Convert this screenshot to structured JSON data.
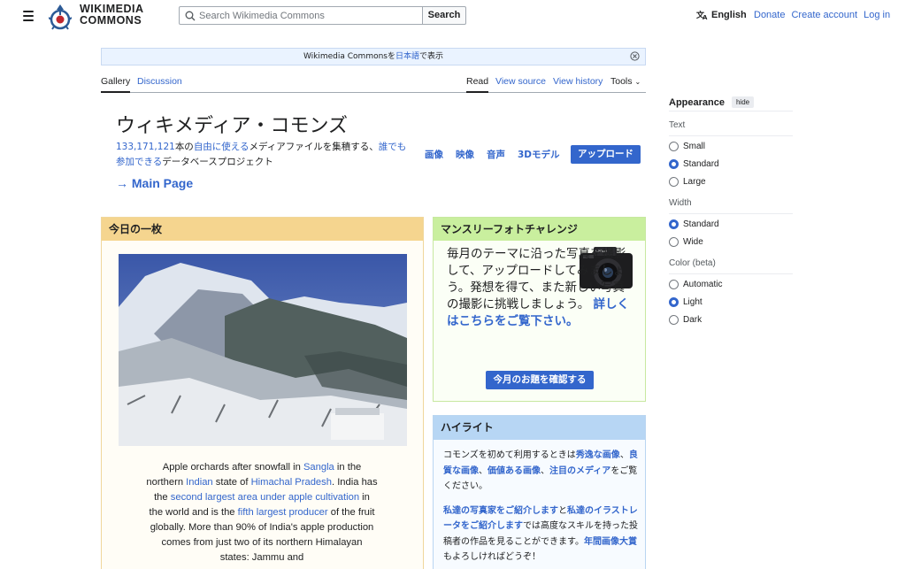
{
  "header": {
    "logo_line1": "WIKIMEDIA",
    "logo_line2": "COMMONS",
    "search_placeholder": "Search Wikimedia Commons",
    "search_button": "Search",
    "language": "English",
    "nav": [
      "Donate",
      "Create account",
      "Log in"
    ]
  },
  "banner": {
    "text_before": "Wikimedia Commonsを",
    "link": "日本語",
    "text_after": "で表示"
  },
  "tabs": {
    "gallery": "Gallery",
    "discussion": "Discussion",
    "read": "Read",
    "view_source": "View source",
    "view_history": "View history",
    "tools": "Tools"
  },
  "appearance": {
    "title": "Appearance",
    "hide": "hide",
    "text_label": "Text",
    "text_options": [
      "Small",
      "Standard",
      "Large"
    ],
    "text_selected": "Standard",
    "width_label": "Width",
    "width_options": [
      "Standard",
      "Wide"
    ],
    "width_selected": "Standard",
    "color_label": "Color (beta)",
    "color_options": [
      "Automatic",
      "Light",
      "Dark"
    ],
    "color_selected": "Light"
  },
  "main": {
    "title": "ウィキメディア・コモンズ",
    "count": "133,171,121",
    "intro_1": "本の",
    "intro_link1": "自由に使える",
    "intro_2": "メディアファイルを集積する、",
    "intro_link2": "誰でも参加できる",
    "intro_3": "データベースプロジェクト",
    "main_page": "→ Main Page",
    "media_links": [
      "画像",
      "映像",
      "音声",
      "3Dモデル"
    ],
    "upload": "アップロード"
  },
  "potd": {
    "heading": "今日の一枚",
    "c1": "Apple orchards after snowfall in ",
    "c_sangla": "Sangla",
    "c2": " in the northern ",
    "c_indian": "Indian",
    "c3": " state of ",
    "c_hp": "Himachal Pradesh",
    "c4": ". India has the ",
    "c_second": "second largest area under apple cultivation",
    "c5": " in the world and is the ",
    "c_fifth": "fifth largest producer",
    "c6": " of the fruit globally. More than 90% of India's apple production comes from just two of its northern Himalayan states: Jammu and"
  },
  "monthly": {
    "heading": "マンスリーフォトチャレンジ",
    "text": "毎月のテーマに沿った写真を撮影して、アップロードしてみましょう。発想を得て、また新しい写真の撮影に挑戦しましょう。",
    "link": "詳しくはこちらをご覧下さい。",
    "button": "今月のお題を確認する"
  },
  "highlight": {
    "heading": "ハイライト",
    "p1_a": "コモンズを初めて利用するときは",
    "p1_l1": "秀逸な画像",
    "p1_b": "、",
    "p1_l2": "良質な画像",
    "p1_c": "、",
    "p1_l3": "価値ある画像",
    "p1_d": "、",
    "p1_l4": "注目のメディア",
    "p1_e": "をご覧ください。",
    "p2_l1": "私達の写真家をご紹介します",
    "p2_a": "と",
    "p2_l2": "私達のイラストレータをご紹介します",
    "p2_b": "では高度なスキルを持った投稿者の作品を見ることができます。",
    "p2_l3": "年間画像大賞",
    "p2_c": "もよろしければどうぞ！"
  },
  "colors": {
    "link": "#3366cc",
    "potd_header": "#f5d58f",
    "monthly_header": "#c9ef9e",
    "highlight_header": "#b7d6f4"
  }
}
